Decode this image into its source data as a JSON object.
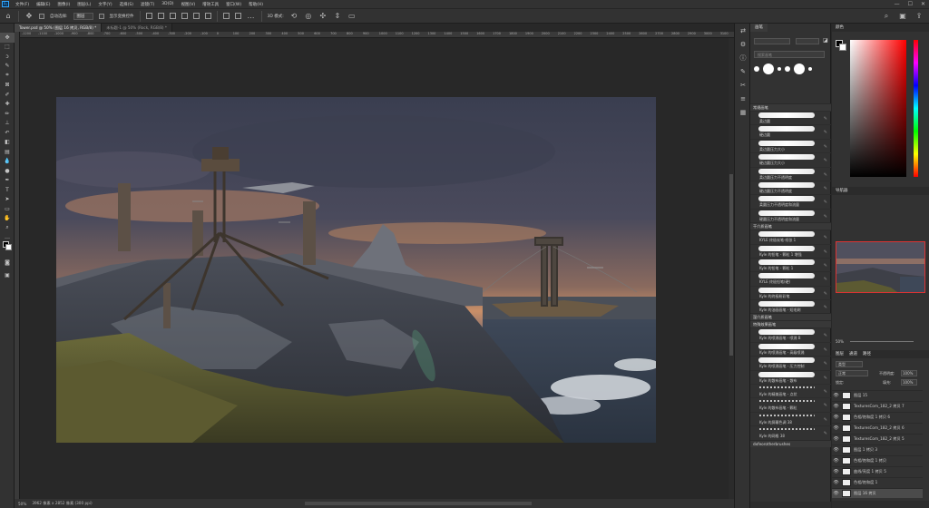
{
  "menubar": {
    "logo": "Ps",
    "items": [
      "文件(F)",
      "编辑(E)",
      "图像(I)",
      "图层(L)",
      "文字(Y)",
      "选择(S)",
      "滤镜(T)",
      "3D(D)",
      "视图(V)",
      "增效工具",
      "窗口(W)",
      "帮助(H)"
    ],
    "controls": [
      "—",
      "☐",
      "✕"
    ]
  },
  "optionsbar": {
    "auto_select_label": "自动选择:",
    "auto_select_value": "图层",
    "show_transform_label": "显示变换控件",
    "mode_3d_label": "3D 模式:"
  },
  "tabs": [
    {
      "label": "Tower.psd @ 50% (图层 16 拷贝, RGB/8) *",
      "active": true
    },
    {
      "label": "未标题-1 @ 50% (Rock, RGB/8) *",
      "active": false
    }
  ],
  "ruler_ticks": [
    "-1200",
    "-1100",
    "-1000",
    "-900",
    "-800",
    "-700",
    "-600",
    "-500",
    "-400",
    "-300",
    "-200",
    "-100",
    "0",
    "100",
    "200",
    "300",
    "400",
    "500",
    "600",
    "700",
    "800",
    "900",
    "1000",
    "1100",
    "1200",
    "1300",
    "1400",
    "1500",
    "1600",
    "1700",
    "1800",
    "1900",
    "2000",
    "2100",
    "2200",
    "2300",
    "2400",
    "2500",
    "2600",
    "2700",
    "2800",
    "2900",
    "3000",
    "3100",
    "3200"
  ],
  "statusbar": {
    "zoom": "50%",
    "doc_info": "3962 像素 x 2852 像素 (300 ppi)"
  },
  "toolbar": {
    "tools": [
      {
        "name": "move-tool",
        "glyph": "✥"
      },
      {
        "name": "marquee-tool",
        "glyph": "⬚"
      },
      {
        "name": "lasso-tool",
        "glyph": "ↄ"
      },
      {
        "name": "quick-select-tool",
        "glyph": "✎"
      },
      {
        "name": "crop-tool",
        "glyph": "⌗"
      },
      {
        "name": "frame-tool",
        "glyph": "⊠"
      },
      {
        "name": "eyedropper-tool",
        "glyph": "✐"
      },
      {
        "name": "healing-tool",
        "glyph": "✚"
      },
      {
        "name": "brush-tool",
        "glyph": "✏"
      },
      {
        "name": "stamp-tool",
        "glyph": "⊥"
      },
      {
        "name": "history-brush-tool",
        "glyph": "↶"
      },
      {
        "name": "eraser-tool",
        "glyph": "◧"
      },
      {
        "name": "gradient-tool",
        "glyph": "▤"
      },
      {
        "name": "blur-tool",
        "glyph": "💧"
      },
      {
        "name": "dodge-tool",
        "glyph": "●"
      },
      {
        "name": "pen-tool",
        "glyph": "✒"
      },
      {
        "name": "type-tool",
        "glyph": "T"
      },
      {
        "name": "path-select-tool",
        "glyph": "➤"
      },
      {
        "name": "shape-tool",
        "glyph": "▭"
      },
      {
        "name": "hand-tool",
        "glyph": "✋"
      },
      {
        "name": "zoom-tool",
        "glyph": "⌕"
      },
      {
        "name": "more-tools",
        "glyph": "…"
      }
    ]
  },
  "iconstrip": [
    "history",
    "adjust",
    "info",
    "brush",
    "clone",
    "properties",
    "swatches"
  ],
  "brushes": {
    "tab": "画笔",
    "search_placeholder": "搜索画笔",
    "groups": [
      {
        "label": "常规画笔",
        "items": [
          "柔边圆",
          "硬边圆",
          "柔边圆压力大小",
          "硬边圆压力大小",
          "柔边圆压力不透明度",
          "硬边圆压力不透明度",
          "柔圆压力不透明度和流量",
          "硬圆压力不透明度和流量"
        ]
      },
      {
        "label": "干介质画笔",
        "items": [
          "KYLE 终极炭笔-纸张 1",
          "Kyle 的铅笔 - 颗粒 1 增强",
          "Kyle 的铅笔 - 颗粒 1",
          "KYLE 终极铅笔(硬)",
          "Kyle 的终极粉彩笔",
          "Kyle 的油画画笔 - 短毛刷"
        ]
      },
      {
        "label": "湿介质画笔",
        "items": []
      },
      {
        "label": "特殊效果画笔",
        "items": [
          "Kyle 的喷溅画笔 - 喷溅 B",
          "Kyle 的喷溅画笔 - 高级喷溅",
          "Kyle 的喷溅画笔 - 压力控制",
          "Kyle 的散布画笔 - 散布",
          "Kyle 的精美画笔 - 点状",
          "Kyle 的散布画笔 - 颗粒",
          "Kyle 的屏幕色调 38",
          "Kyle 的网格 38"
        ]
      },
      {
        "label": "dxfeorotherbrushes",
        "items": []
      }
    ]
  },
  "rightcol": {
    "color_tab": "颜色",
    "navigator_tab": "导航器",
    "nav_zoom": "50%",
    "layer_tabs": [
      "图层",
      "通道",
      "路径"
    ],
    "kind_label": "类型",
    "blend_mode": "正常",
    "opacity_label": "不透明度:",
    "opacity_value": "100%",
    "lock_label": "锁定:",
    "fill_label": "填充:",
    "fill_value": "100%",
    "layers": [
      "图层 15",
      "TexturesCom_182_2 拷贝 7",
      "色相/饱和度 1 拷贝 6",
      "TexturesCom_182_2 拷贝 6",
      "TexturesCom_182_2 拷贝 5",
      "图层 1 拷贝 3",
      "色相/饱和度 1 拷贝",
      "曲线/亮度 1 拷贝 5",
      "色相/饱和度 1",
      "图层 16 拷贝"
    ],
    "active_layer_index": 9
  }
}
